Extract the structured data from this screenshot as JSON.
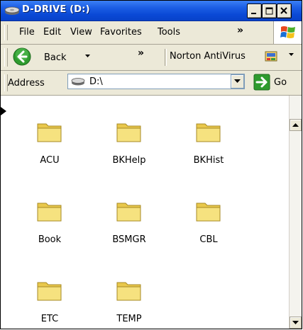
{
  "window": {
    "title": "D-DRIVE (D:)",
    "colors": {
      "title_bar": "#0a49d6",
      "chrome": "#ece9d8",
      "go_green": "#2e9b2e",
      "folder_yellow": "#f6e27f"
    }
  },
  "title_icon": "hard-drive-icon",
  "menu": {
    "items": [
      "File",
      "Edit",
      "View",
      "Favorites",
      "Tools"
    ],
    "overflow": "»",
    "logo": "windows-logo-icon"
  },
  "toolbar": {
    "back_label": "Back",
    "overflow": "»",
    "norton_label": "Norton AntiVirus"
  },
  "address": {
    "label": "Address",
    "value": "D:\\",
    "go_label": "Go"
  },
  "folders": [
    {
      "name": "ACU"
    },
    {
      "name": "BKHelp"
    },
    {
      "name": "BKHist"
    },
    {
      "name": "Book"
    },
    {
      "name": "BSMGR"
    },
    {
      "name": "CBL"
    },
    {
      "name": "ETC"
    },
    {
      "name": "TEMP"
    }
  ]
}
